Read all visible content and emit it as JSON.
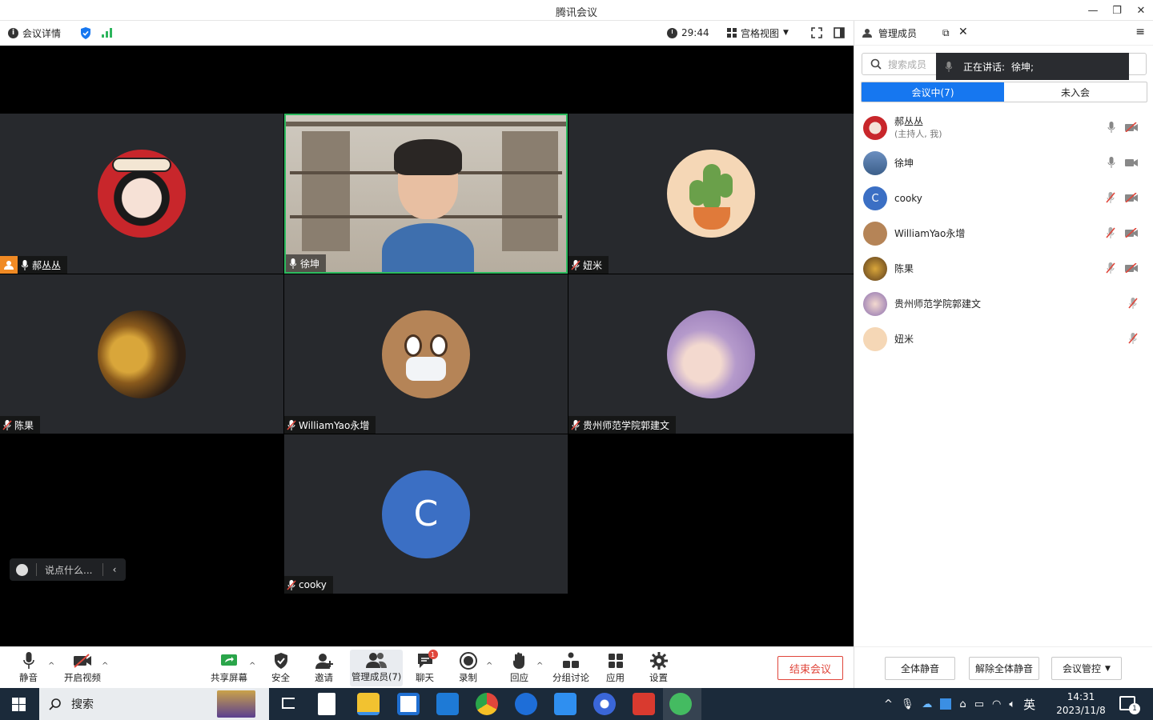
{
  "window": {
    "title": "腾讯会议",
    "minimize": "—",
    "restore": "❐",
    "close": "✕"
  },
  "topbar": {
    "meeting_info": "会议详情",
    "timer": "29:44",
    "view_mode": "宫格视图"
  },
  "participants_tiles": [
    {
      "name": "郝丛丛",
      "host": true
    },
    {
      "name": "徐坤",
      "active": true
    },
    {
      "name": "妞米"
    },
    {
      "name": "陈果"
    },
    {
      "name": "WilliamYao永增"
    },
    {
      "name": "贵州师范学院郭建文"
    },
    {
      "name": "cooky",
      "initial": "C"
    }
  ],
  "chat": {
    "placeholder": "说点什么..."
  },
  "panel": {
    "title": "管理成员",
    "search_placeholder": "搜索成员",
    "speaking_label": "正在讲话:",
    "speaking_name": "徐坤;",
    "tab_in": "会议中(7)",
    "tab_out": "未入会",
    "members": [
      {
        "name": "郝丛丛",
        "sub": "(主持人, 我)",
        "mic": "on",
        "cam": "off"
      },
      {
        "name": "徐坤",
        "sub": "",
        "mic": "on",
        "cam": "on"
      },
      {
        "name": "cooky",
        "sub": "",
        "mic": "off",
        "cam": "off",
        "initial": "C"
      },
      {
        "name": "WilliamYao永增",
        "sub": "",
        "mic": "off",
        "cam": "off"
      },
      {
        "name": "陈果",
        "sub": "",
        "mic": "off",
        "cam": "off"
      },
      {
        "name": "贵州师范学院郭建文",
        "sub": "",
        "mic": "off",
        "cam": "none"
      },
      {
        "name": "妞米",
        "sub": "",
        "mic": "off",
        "cam": "none"
      }
    ],
    "footer": {
      "mute_all": "全体静音",
      "unmute_all": "解除全体静音",
      "controls": "会议管控"
    }
  },
  "toolbar": {
    "mute": "静音",
    "video": "开启视频",
    "share": "共享屏幕",
    "security": "安全",
    "invite": "邀请",
    "members": "管理成员(7)",
    "chat": "聊天",
    "chat_badge": "1",
    "record": "录制",
    "react": "回应",
    "breakout": "分组讨论",
    "apps": "应用",
    "settings": "设置",
    "end": "结束会议"
  },
  "taskbar": {
    "search": "搜索",
    "ime": "英",
    "time": "14:31",
    "date": "2023/11/8",
    "notif": "1"
  },
  "colors": {
    "accent": "#1677f0",
    "active_border": "#2dbb5f",
    "end": "#e0463b",
    "muted": "#e0463b"
  }
}
